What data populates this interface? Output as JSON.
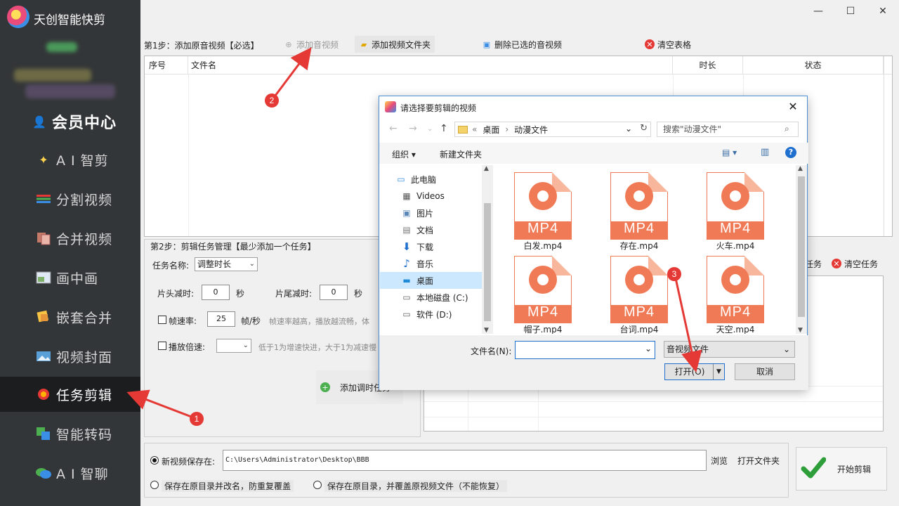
{
  "app": {
    "title": "天创智能快剪"
  },
  "window": {
    "minimize": "—",
    "maximize": "☐",
    "close": "✕"
  },
  "sidebar": {
    "items": [
      {
        "label": "会员中心",
        "icon": "vip-avatar-icon"
      },
      {
        "label": "A I 智剪",
        "icon": "ai-edit-icon"
      },
      {
        "label": "分割视频",
        "icon": "split-video-icon"
      },
      {
        "label": "合并视频",
        "icon": "merge-video-icon"
      },
      {
        "label": "画中画",
        "icon": "picture-in-picture-icon"
      },
      {
        "label": "嵌套合并",
        "icon": "nested-merge-icon"
      },
      {
        "label": "视频封面",
        "icon": "video-cover-icon"
      },
      {
        "label": "任务剪辑",
        "icon": "task-edit-icon"
      },
      {
        "label": "智能转码",
        "icon": "transcode-icon"
      },
      {
        "label": "A I 智聊",
        "icon": "ai-chat-icon"
      }
    ],
    "active_index": 7
  },
  "step1": {
    "label": "第1步：添加原音视频【必选】",
    "add_av": "添加音视频",
    "add_folder": "添加视频文件夹",
    "delete_selected": "删除已选的音视频",
    "clear_table": "清空表格",
    "columns": [
      "序号",
      "文件名",
      "时长",
      "状态"
    ]
  },
  "step2": {
    "label": "第2步：剪辑任务管理【最少添加一个任务】",
    "task_name_label": "任务名称:",
    "task_name_value": "调整时长",
    "head_cut_label": "片头减时:",
    "head_cut_value": "0",
    "tail_cut_label": "片尾减时:",
    "tail_cut_value": "0",
    "seconds": "秒",
    "fps_label": "帧速率:",
    "fps_value": "25",
    "fps_unit": "帧/秒",
    "fps_hint": "帧速率越高，播放越流畅，体",
    "speed_label": "播放倍速:",
    "speed_hint": "低于1为增速快进，大于1为减速慢",
    "add_task": "添加调时任务",
    "task_right": "任务",
    "clear_tasks": "清空任务"
  },
  "output": {
    "save_new_label": "新视频保存在:",
    "path": "C:\\Users\\Administrator\\Desktop\\BBB",
    "browse": "浏览",
    "open_folder": "打开文件夹",
    "opt_rename": "保存在原目录并改名，防重复覆盖",
    "opt_overwrite": "保存在原目录，并覆盖原视频文件（不能恢复）",
    "start": "开始剪辑"
  },
  "dialog": {
    "title": "请选择要剪辑的视频",
    "breadcrumb": [
      "«",
      "桌面",
      "›",
      "动漫文件"
    ],
    "search_placeholder": "搜索\"动漫文件\"",
    "organize": "组织 ▾",
    "new_folder": "新建文件夹",
    "tree": [
      {
        "label": "此电脑",
        "icon": "computer-icon"
      },
      {
        "label": "Videos",
        "icon": "videos-folder-icon"
      },
      {
        "label": "图片",
        "icon": "pictures-folder-icon"
      },
      {
        "label": "文档",
        "icon": "documents-folder-icon"
      },
      {
        "label": "下载",
        "icon": "download-folder-icon"
      },
      {
        "label": "音乐",
        "icon": "music-folder-icon"
      },
      {
        "label": "桌面",
        "icon": "desktop-folder-icon"
      },
      {
        "label": "本地磁盘 (C:)",
        "icon": "drive-c-icon"
      },
      {
        "label": "软件 (D:)",
        "icon": "drive-d-icon"
      }
    ],
    "tree_selected": 6,
    "file_ext_label": "MP4",
    "files": [
      "白发.mp4",
      "存在.mp4",
      "火车.mp4",
      "帽子.mp4",
      "台词.mp4",
      "天空.mp4"
    ],
    "filename_label": "文件名(N):",
    "filename_value": "",
    "filetype": "音视频文件",
    "open": "打开(O)",
    "cancel": "取消"
  },
  "annotations": {
    "b1": "1",
    "b2": "2",
    "b3": "3",
    "color": "#e53935"
  }
}
